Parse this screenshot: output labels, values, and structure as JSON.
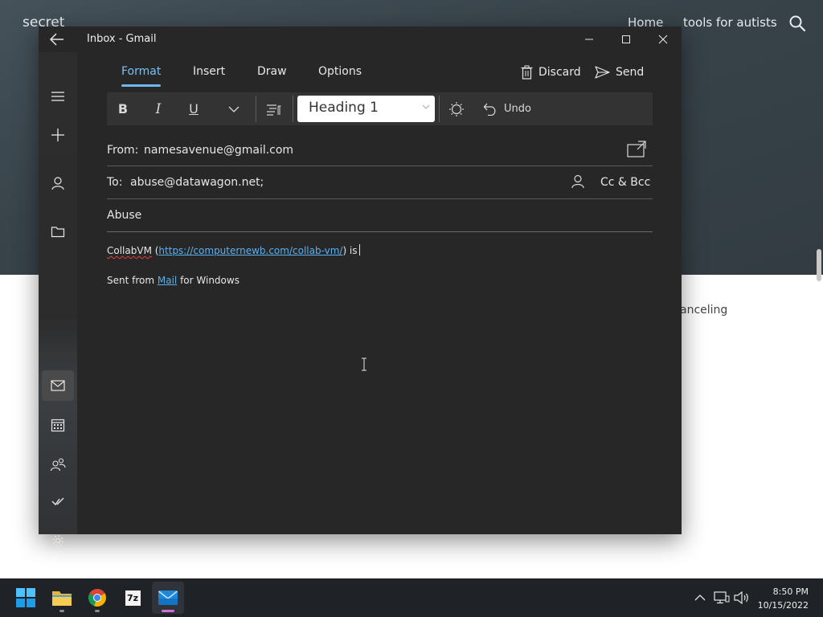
{
  "background": {
    "brand": "secret",
    "nav": {
      "home": "Home",
      "tools": "tools for autists"
    },
    "body_text": "anceling",
    "colors": {
      "header": "#3a454c"
    }
  },
  "window": {
    "title": "Inbox - Gmail",
    "ribbon_tabs": [
      "Format",
      "Insert",
      "Draw",
      "Options"
    ],
    "active_tab": "Format",
    "discard_label": "Discard",
    "send_label": "Send",
    "toolbar": {
      "bold": "B",
      "italic": "I",
      "underline": "U",
      "style_value": "Heading 1",
      "undo_label": "Undo"
    },
    "from_label": "From:",
    "from_value": "namesavenue@gmail.com",
    "to_label": "To:",
    "to_value": "abuse@datawagon.net;",
    "cc_bcc_label": "Cc & Bcc",
    "subject": "Abuse",
    "body": {
      "line1_word": "CollabVM",
      "line1_open": " (",
      "line1_link": "https://computernewb.com/collab-vm/",
      "line1_close": ") is",
      "line2_pre": "Sent from ",
      "line2_link": "Mail",
      "line2_post": " for Windows"
    },
    "colors": {
      "accent": "#7cc0f2",
      "link": "#5ab0f0",
      "window_bg": "#272727"
    }
  },
  "taskbar": {
    "apps": [
      "start-icon",
      "file-explorer-icon",
      "chrome-icon",
      "7zip-icon",
      "mail-icon"
    ],
    "sevenzip_label": "7z",
    "time": "8:50 PM",
    "date": "10/15/2022"
  }
}
